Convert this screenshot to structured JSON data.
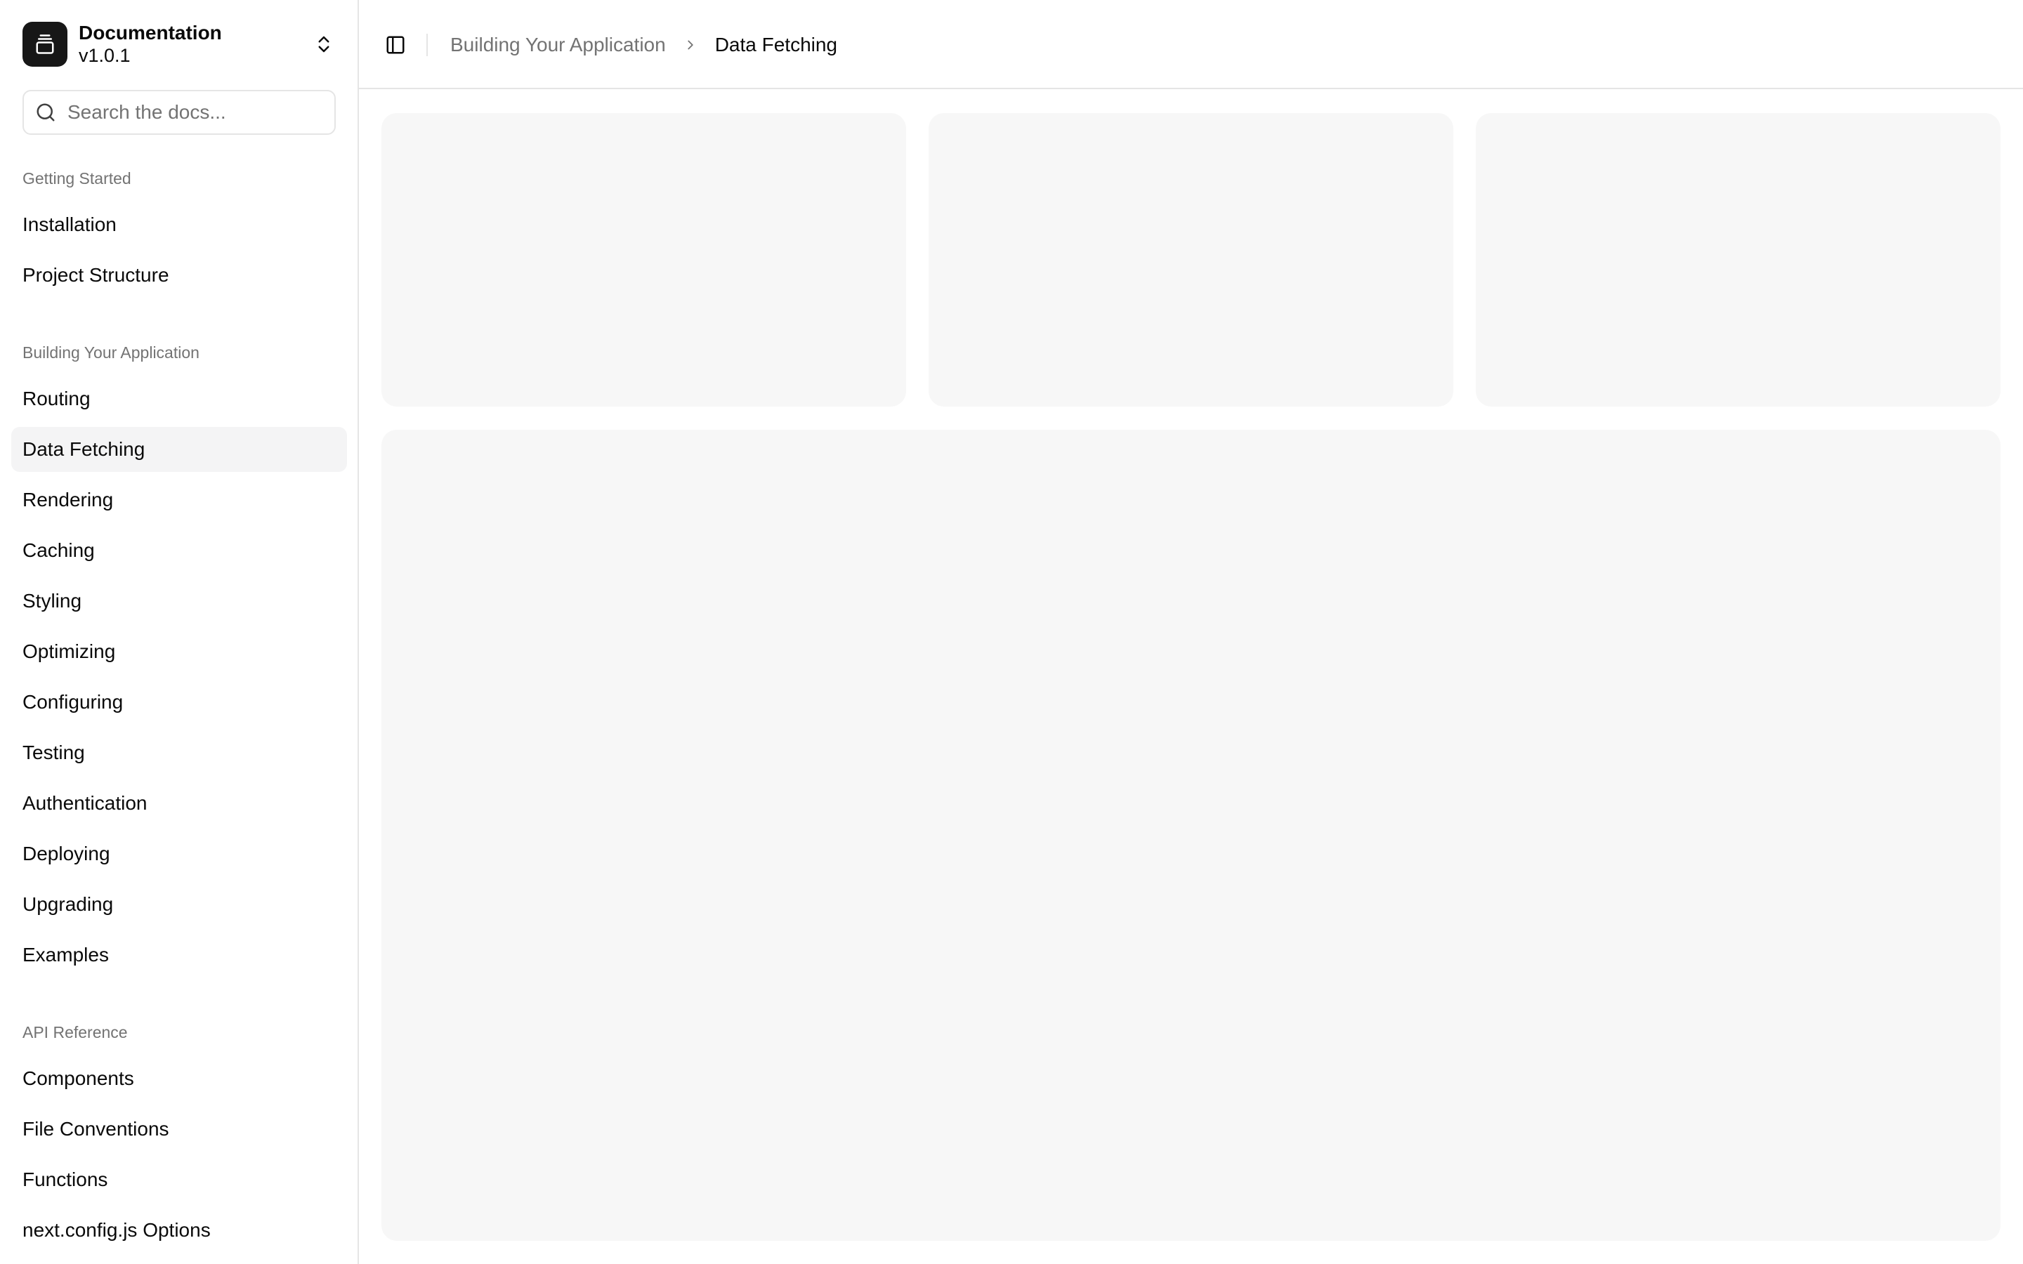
{
  "sidebar": {
    "team": {
      "name": "Documentation",
      "version": "v1.0.1"
    },
    "search": {
      "placeholder": "Search the docs..."
    },
    "groups": [
      {
        "label": "Getting Started",
        "items": [
          {
            "label": "Installation"
          },
          {
            "label": "Project Structure"
          }
        ]
      },
      {
        "label": "Building Your Application",
        "items": [
          {
            "label": "Routing"
          },
          {
            "label": "Data Fetching"
          },
          {
            "label": "Rendering"
          },
          {
            "label": "Caching"
          },
          {
            "label": "Styling"
          },
          {
            "label": "Optimizing"
          },
          {
            "label": "Configuring"
          },
          {
            "label": "Testing"
          },
          {
            "label": "Authentication"
          },
          {
            "label": "Deploying"
          },
          {
            "label": "Upgrading"
          },
          {
            "label": "Examples"
          }
        ]
      },
      {
        "label": "API Reference",
        "items": [
          {
            "label": "Components"
          },
          {
            "label": "File Conventions"
          },
          {
            "label": "Functions"
          },
          {
            "label": "next.config.js Options"
          }
        ]
      }
    ],
    "active_item": "Data Fetching"
  },
  "header": {
    "breadcrumb": {
      "parent": "Building Your Application",
      "current": "Data Fetching"
    }
  },
  "icons": {
    "team_logo": "gallery-vertical-end-icon",
    "team_switch": "chevrons-up-down-icon",
    "search": "search-icon",
    "sidebar_toggle": "panel-left-icon",
    "breadcrumb_separator": "chevron-right-icon"
  },
  "colors": {
    "foreground": "#0a0a0a",
    "muted": "#737373",
    "border": "#e5e5e5",
    "skeleton": "#f7f7f7",
    "active_item_bg": "#f4f4f5",
    "logo_bg": "#171717"
  }
}
